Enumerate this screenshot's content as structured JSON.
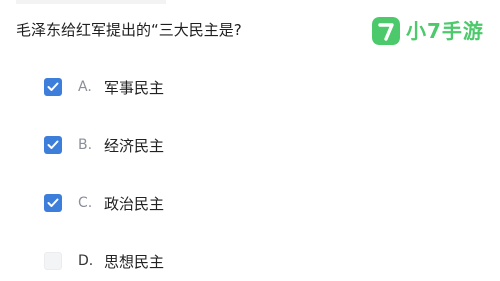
{
  "question": "毛泽东给红军提出的“三大民主是?",
  "brand": {
    "name": "小7手游",
    "logo_glyph": "7",
    "color": "#4cc96b"
  },
  "accent_color": "#3d7edb",
  "options": [
    {
      "letter": "A.",
      "text": "军事民主",
      "checked": true
    },
    {
      "letter": "B.",
      "text": "经济民主",
      "checked": true
    },
    {
      "letter": "C.",
      "text": "政治民主",
      "checked": true
    },
    {
      "letter": "D.",
      "text": "思想民主",
      "checked": false
    }
  ]
}
